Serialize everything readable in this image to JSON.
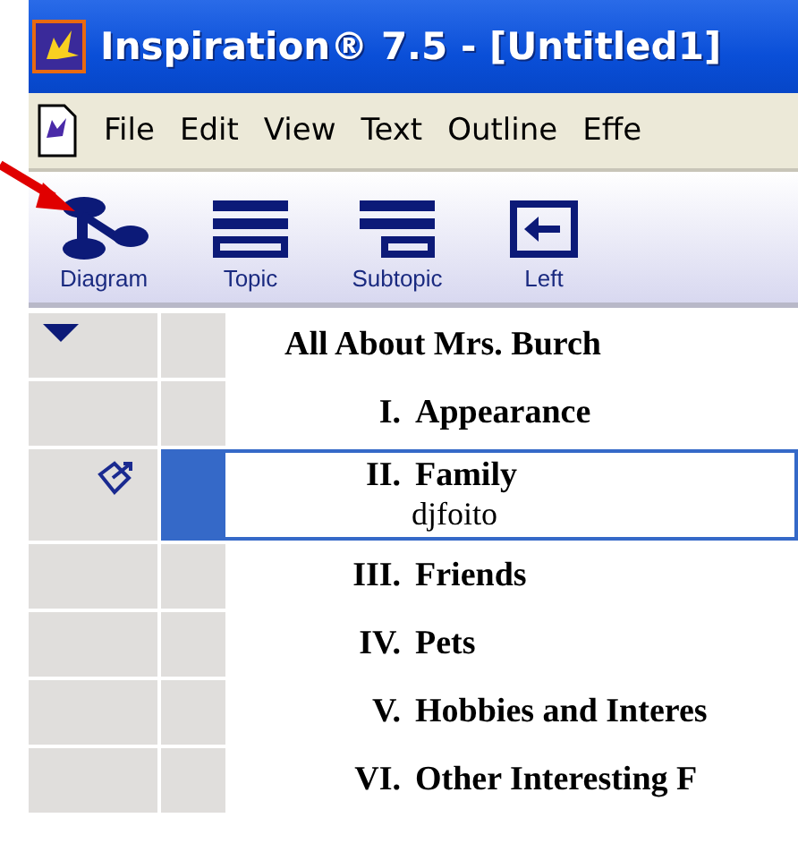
{
  "window": {
    "title": "Inspiration® 7.5 - [Untitled1]"
  },
  "menu": [
    "File",
    "Edit",
    "View",
    "Text",
    "Outline",
    "Effe"
  ],
  "toolbar": [
    {
      "kind": "diagram",
      "label": "Diagram"
    },
    {
      "kind": "topic",
      "label": "Topic"
    },
    {
      "kind": "subtopic",
      "label": "Subtopic"
    },
    {
      "kind": "left",
      "label": "Left"
    }
  ],
  "outline": {
    "title": "All About Mrs. Burch",
    "expanded": true,
    "children": [
      {
        "numeral": "I.",
        "title": "Appearance",
        "selected": false,
        "has_note": false
      },
      {
        "numeral": "II.",
        "title": "Family",
        "note": "djfoito",
        "selected": true,
        "has_note": true
      },
      {
        "numeral": "III.",
        "title": "Friends",
        "selected": false,
        "has_note": false
      },
      {
        "numeral": "IV.",
        "title": "Pets",
        "selected": false,
        "has_note": false
      },
      {
        "numeral": "V.",
        "title": "Hobbies and Interes",
        "selected": false,
        "has_note": false
      },
      {
        "numeral": "VI.",
        "title": "Other Interesting F",
        "selected": false,
        "has_note": false
      }
    ]
  }
}
